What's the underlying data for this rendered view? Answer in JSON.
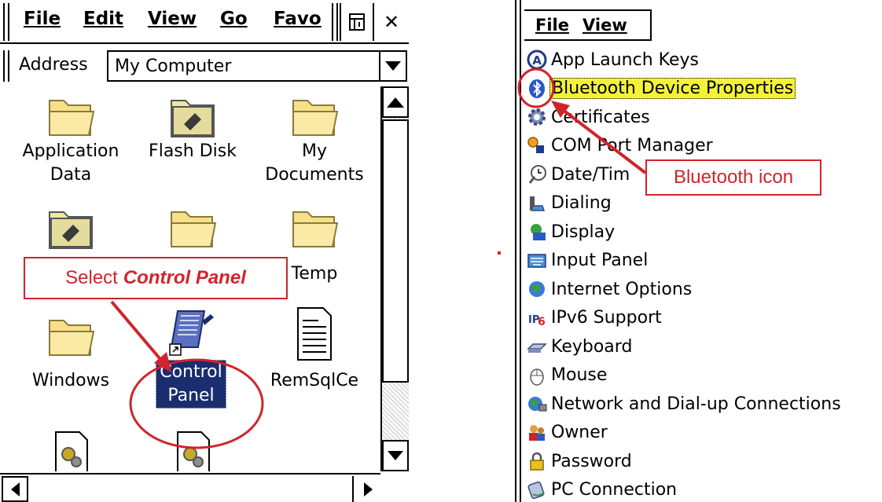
{
  "left_window": {
    "menu": [
      "File",
      "Edit",
      "View",
      "Go",
      "Favo"
    ],
    "address_label": "Address",
    "address_value": "My Computer",
    "items": [
      {
        "label": "Application\nData",
        "icon": "folder-icon"
      },
      {
        "label": "Flash Disk",
        "icon": "flash-disk-icon"
      },
      {
        "label": "My\nDocuments",
        "icon": "folder-icon"
      },
      {
        "label": "",
        "icon": "flash-disk-icon"
      },
      {
        "label": "",
        "icon": "folder-icon"
      },
      {
        "label": "Temp",
        "icon": "folder-icon"
      },
      {
        "label": "Windows",
        "icon": "folder-icon"
      },
      {
        "label": "Control\nPanel",
        "icon": "control-panel-icon",
        "selected": true
      },
      {
        "label": "RemSqlCe",
        "icon": "document-icon"
      },
      {
        "label": "",
        "icon": "settings-file-icon"
      },
      {
        "label": "",
        "icon": "settings-file-icon"
      }
    ],
    "callout": {
      "prefix": "Select",
      "emphasis": "Control Panel"
    }
  },
  "right_window": {
    "menu": [
      "File",
      "View"
    ],
    "items": [
      {
        "label": "App Launch Keys",
        "icon": "app-launch-keys-icon"
      },
      {
        "label": "Bluetooth Device Properties",
        "icon": "bluetooth-icon",
        "highlighted": true
      },
      {
        "label": "Certificates",
        "icon": "certificates-icon"
      },
      {
        "label": "COM Port Manager",
        "icon": "com-port-icon"
      },
      {
        "label": "Date/Tim",
        "icon": "date-time-icon"
      },
      {
        "label": "Dialing",
        "icon": "dialing-icon"
      },
      {
        "label": "Display",
        "icon": "display-icon"
      },
      {
        "label": "Input Panel",
        "icon": "input-panel-icon"
      },
      {
        "label": "Internet Options",
        "icon": "internet-options-icon"
      },
      {
        "label": "IPv6 Support",
        "icon": "ipv6-icon"
      },
      {
        "label": "Keyboard",
        "icon": "keyboard-icon"
      },
      {
        "label": "Mouse",
        "icon": "mouse-icon"
      },
      {
        "label": "Network and Dial-up Connections",
        "icon": "network-icon"
      },
      {
        "label": "Owner",
        "icon": "owner-icon"
      },
      {
        "label": "Password",
        "icon": "password-icon"
      },
      {
        "label": "PC Connection",
        "icon": "pc-connection-icon"
      }
    ],
    "callout": "Bluetooth icon"
  },
  "colors": {
    "annotation_red": "#d0242b",
    "selection_navy": "#1a2d6e",
    "highlight_yellow": "#f3f23a",
    "folder_yellow": "#f7e08a"
  }
}
